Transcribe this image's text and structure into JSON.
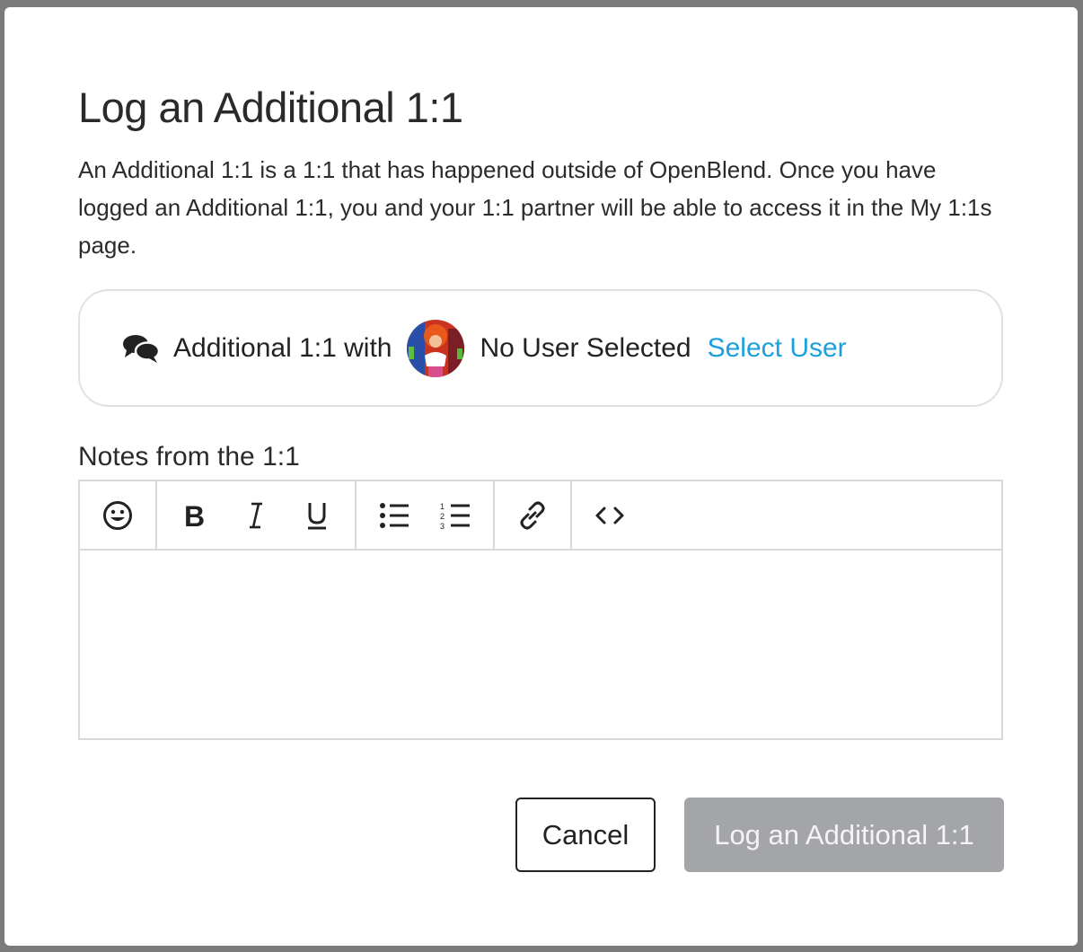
{
  "modal": {
    "title": "Log an Additional 1:1",
    "description": "An Additional 1:1 is a 1:1 that has happened outside of OpenBlend. Once you have logged an Additional 1:1, you and your 1:1 partner will be able to access it in the My 1:1s page."
  },
  "partner": {
    "icon": "chat-bubbles-icon",
    "label": "Additional 1:1 with",
    "selected_user": "No User Selected",
    "select_link": "Select User"
  },
  "notes": {
    "label": "Notes from the 1:1",
    "value": "",
    "toolbar": [
      {
        "icon": "emoji-icon"
      },
      {
        "icon": "bold-icon"
      },
      {
        "icon": "italic-icon"
      },
      {
        "icon": "underline-icon"
      },
      {
        "icon": "bullet-list-icon"
      },
      {
        "icon": "numbered-list-icon"
      },
      {
        "icon": "link-icon"
      },
      {
        "icon": "code-icon"
      }
    ]
  },
  "actions": {
    "cancel": "Cancel",
    "submit": "Log an Additional 1:1"
  },
  "colors": {
    "accent": "#1aa1dd",
    "disabled_button": "#a3a5a8",
    "text": "#222222"
  }
}
